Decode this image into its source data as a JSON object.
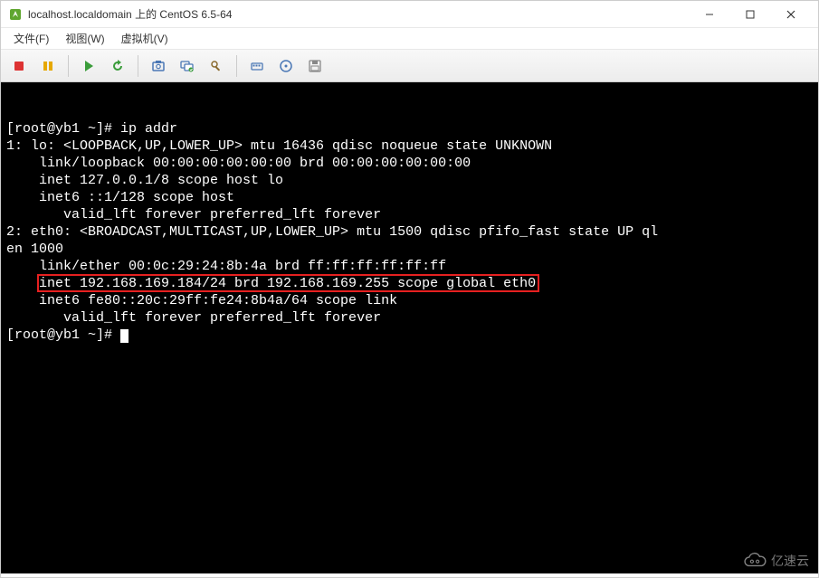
{
  "window": {
    "title": "localhost.localdomain 上的 CentOS 6.5-64"
  },
  "menu": {
    "file": "文件(F)",
    "view": "视图(W)",
    "vm": "虚拟机(V)"
  },
  "toolbar": {
    "stop": "stop",
    "pause": "pause",
    "play": "play",
    "restart": "restart",
    "snapshot": "snapshot",
    "snapshot_mgr": "snapshot-manager",
    "guest_tools": "guest-tools",
    "send_cad": "send-ctrl-alt-del",
    "cdrom": "cdrom",
    "floppy": "floppy"
  },
  "terminal": {
    "lines": [
      "[root@yb1 ~]# ip addr",
      "1: lo: <LOOPBACK,UP,LOWER_UP> mtu 16436 qdisc noqueue state UNKNOWN",
      "    link/loopback 00:00:00:00:00:00 brd 00:00:00:00:00:00",
      "    inet 127.0.0.1/8 scope host lo",
      "    inet6 ::1/128 scope host",
      "       valid_lft forever preferred_lft forever",
      "2: eth0: <BROADCAST,MULTICAST,UP,LOWER_UP> mtu 1500 qdisc pfifo_fast state UP ql",
      "en 1000",
      "    link/ether 00:0c:29:24:8b:4a brd ff:ff:ff:ff:ff:ff",
      "    inet 192.168.169.184/24 brd 192.168.169.255 scope global eth0",
      "    inet6 fe80::20c:29ff:fe24:8b4a/64 scope link",
      "       valid_lft forever preferred_lft forever",
      "[root@yb1 ~]# "
    ],
    "highlighted_line_index": 9
  },
  "watermark": {
    "text": "亿速云"
  }
}
